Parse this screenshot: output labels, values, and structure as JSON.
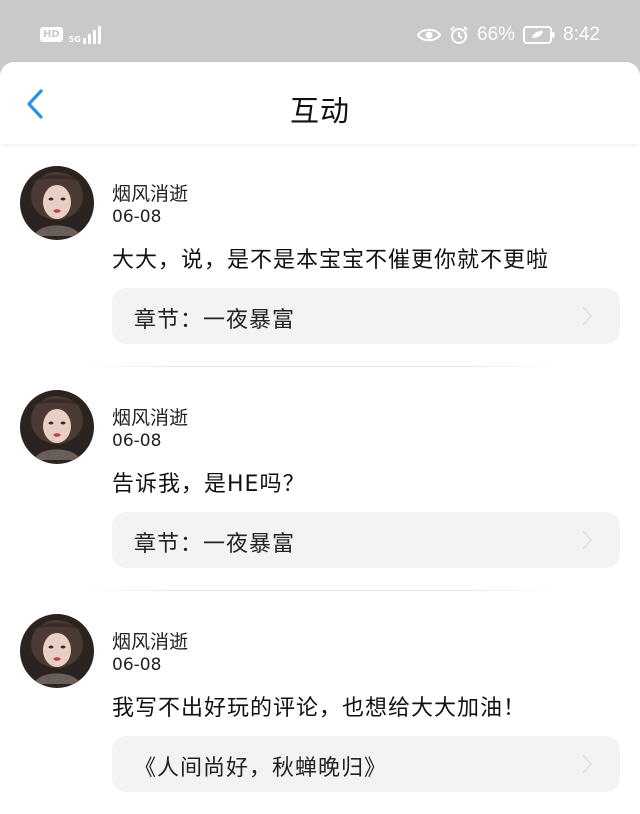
{
  "status_bar": {
    "hd": "HD",
    "network": "5G",
    "battery": "66%",
    "time": "8:42",
    "icons": [
      "eye-comfort-icon",
      "alarm-icon",
      "battery-icon"
    ]
  },
  "header": {
    "title": "互动",
    "back_icon": "chevron-left-icon",
    "accent_color": "#2f8fe0"
  },
  "comments": [
    {
      "user": "烟风消逝",
      "date": "06-08",
      "text": "大大，说，是不是本宝宝不催更你就不更啦",
      "chapter": "章节：一夜暴富"
    },
    {
      "user": "烟风消逝",
      "date": "06-08",
      "text": "告诉我，是HE吗？",
      "chapter": "章节：一夜暴富"
    },
    {
      "user": "烟风消逝",
      "date": "06-08",
      "text": "我写不出好玩的评论，也想给大大加油！",
      "chapter": "《人间尚好，秋蝉晚归》"
    }
  ]
}
